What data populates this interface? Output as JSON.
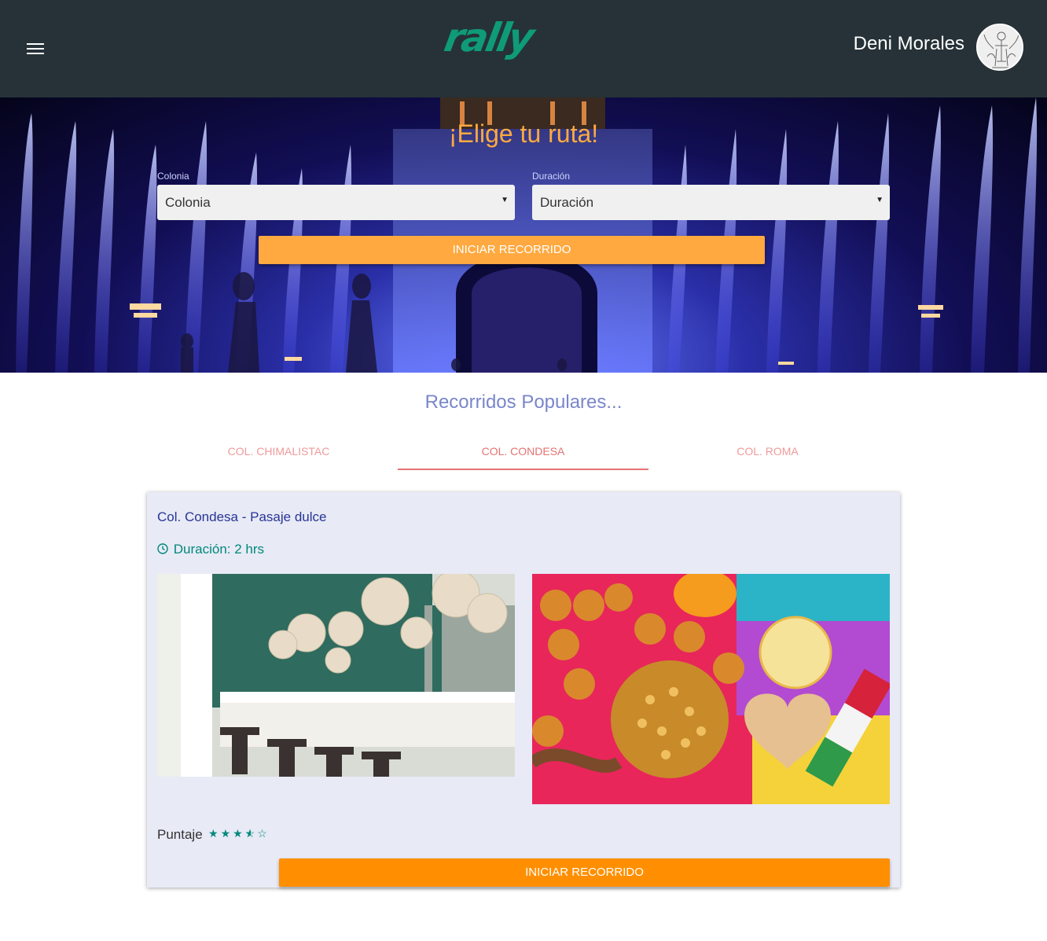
{
  "header": {
    "logo": "rally",
    "user_name": "Deni Morales",
    "icons": {
      "menu": "menu-icon",
      "avatar": "user-avatar"
    }
  },
  "hero": {
    "title": "¡Elige tu ruta!",
    "colonia": {
      "label": "Colonia",
      "value": "Colonia"
    },
    "duracion": {
      "label": "Duración",
      "value": "Duración"
    },
    "button": "INICIAR RECORRIDO"
  },
  "popular": {
    "title": "Recorridos Populares...",
    "tabs": [
      {
        "label": "COL. CHIMALISTAC",
        "active": false
      },
      {
        "label": "COL. CONDESA",
        "active": true
      },
      {
        "label": "COL. ROMA",
        "active": false
      }
    ]
  },
  "card": {
    "title": "Col. Condesa - Pasaje dulce",
    "duration": "Duración: 2 hrs",
    "score_label": "Puntaje",
    "rating": 3.5,
    "rating_max": 5,
    "button": "INICIAR RECORRIDO"
  },
  "colors": {
    "header_bg": "#263238",
    "accent_orange": "#ffa940",
    "button_orange": "#ff8f00",
    "teal": "#00897b",
    "tab_pink": "#e57373",
    "title_indigo": "#7986cb",
    "card_bg": "#e8eaf6"
  }
}
